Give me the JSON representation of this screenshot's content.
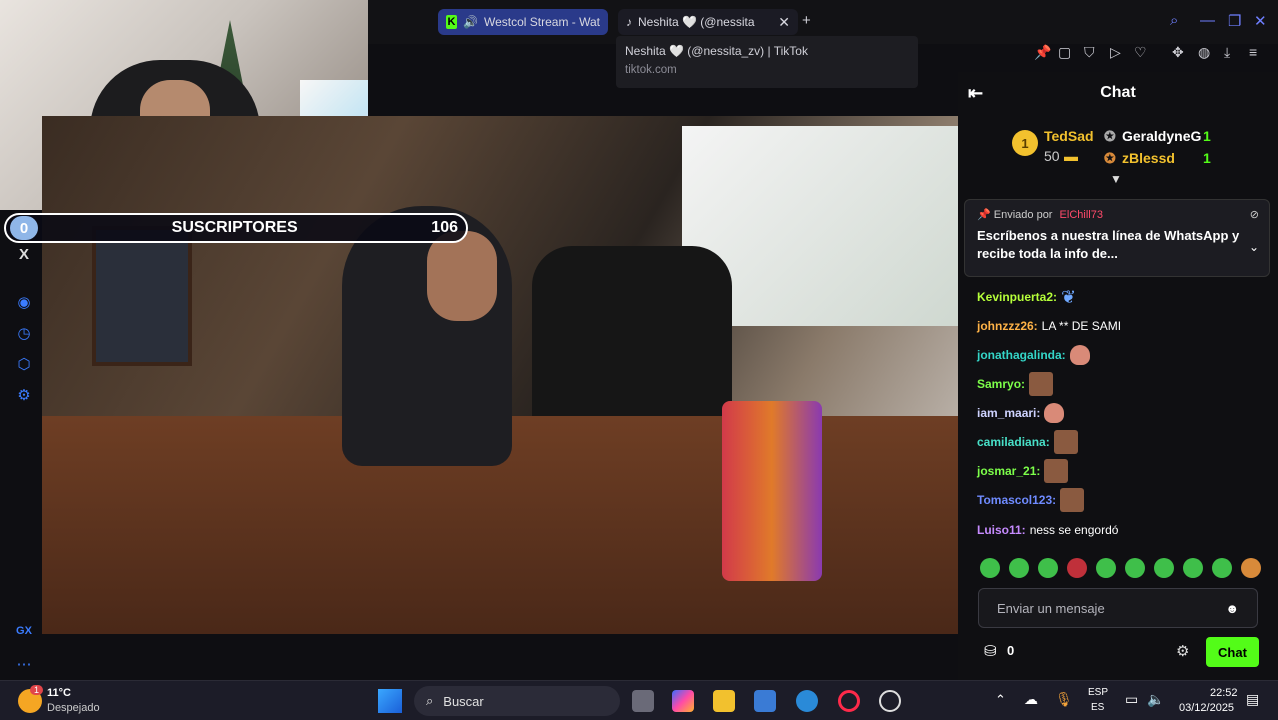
{
  "browser": {
    "tabs": [
      {
        "label": "Westcol Stream - Wat",
        "icon": "kick-logo-icon"
      },
      {
        "label": "Neshita 🤍 (@nessita",
        "icon": "tiktok-icon"
      }
    ],
    "tooltip": {
      "title": "Neshita 🤍 (@nessita_zv) | TikTok",
      "url": "tiktok.com"
    }
  },
  "overlay": {
    "sub_left": "0",
    "sub_title": "SUSCRIPTORES",
    "sub_count": "106"
  },
  "chat": {
    "title": "Chat",
    "leaderboard": {
      "first": {
        "rank": "1",
        "name": "TedSad",
        "count": "50"
      },
      "second": {
        "name": "GeraldyneG",
        "count": "1"
      },
      "third": {
        "name": "zBlessd",
        "count": "1"
      }
    },
    "pinned": {
      "by_label": "Enviado por",
      "by_user": "ElChill73",
      "message": "Escríbenos a nuestra línea de WhatsApp y recibe toda la info de..."
    },
    "messages": [
      {
        "user": "Kevinpuerta2:",
        "text": "",
        "color": "#b6ff3a"
      },
      {
        "user": "johnzzz26:",
        "text": "LA ** DE SAMI",
        "color": "#ffb347"
      },
      {
        "user": "jonathagalinda:",
        "text": "",
        "color": "#34d6c8"
      },
      {
        "user": "Samryo:",
        "text": "",
        "color": "#7dff4a"
      },
      {
        "user": "iam_maari:",
        "text": "",
        "color": "#cfd3ff"
      },
      {
        "user": "camiladiana:",
        "text": "",
        "color": "#48e0c8"
      },
      {
        "user": "josmar_21:",
        "text": "",
        "color": "#7dff4a"
      },
      {
        "user": "Tomascol123:",
        "text": "",
        "color": "#6f8bff"
      },
      {
        "user": "Luiso11:",
        "text": "ness se engordó",
        "color": "#c68bff"
      }
    ],
    "input_placeholder": "Enviar un mensaje",
    "points": "0",
    "send_label": "Chat"
  },
  "taskbar": {
    "weather_temp": "11°C",
    "weather_desc": "Despejado",
    "search_label": "Buscar",
    "lang_top": "ESP",
    "lang_bottom": "ES",
    "time": "22:52",
    "date": "03/12/2025",
    "notification_badge": "1"
  },
  "colors": {
    "kick_green": "#53fc18",
    "tab_active": "#2a3a8a",
    "accent_blue": "#3b7cff"
  }
}
